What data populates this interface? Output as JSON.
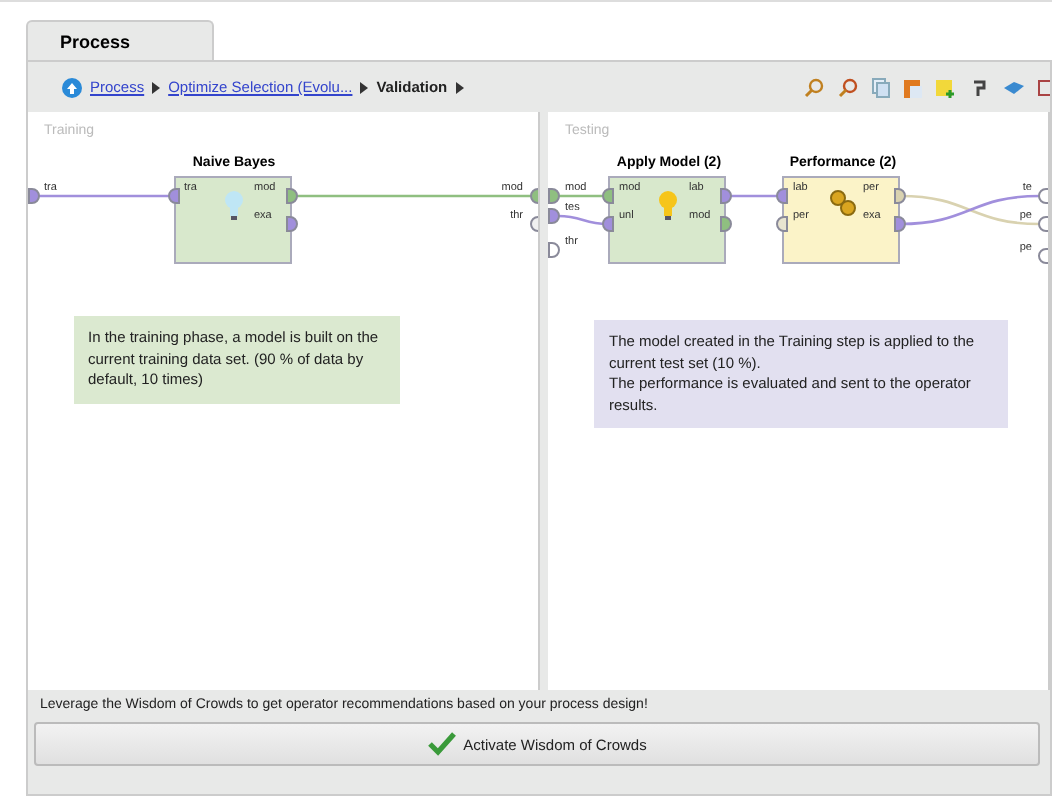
{
  "tab": {
    "label": "Process",
    "selected": true
  },
  "breadcrumb": [
    {
      "label": "Process",
      "kind": "link"
    },
    {
      "label": "Optimize Selection (Evolu...",
      "kind": "link"
    },
    {
      "label": "Validation",
      "kind": "current"
    }
  ],
  "panes": [
    {
      "title": "Training",
      "inputs": [
        {
          "label": "tra",
          "color": "#a18fdc"
        }
      ],
      "outputs": [
        {
          "label": "mod",
          "color": "#8fbf80"
        },
        {
          "label": "thr",
          "color": "#f0f0f0"
        }
      ],
      "operators": [
        {
          "name": "Naive Bayes",
          "kind": "learner",
          "inputs": [
            {
              "label": "tra",
              "color": "#a18fdc"
            }
          ],
          "outputs": [
            {
              "label": "mod",
              "color": "#8fbf80"
            },
            {
              "label": "exa",
              "color": "#a18fdc"
            }
          ]
        }
      ],
      "note": {
        "text": "In the training phase, a model is built on the current training data set. (90 % of data by default, 10 times)",
        "color": "#dbe9d0"
      }
    },
    {
      "title": "Testing",
      "inputs": [
        {
          "label": "mod",
          "color": "#8fbf80"
        },
        {
          "label": "tes",
          "color": "#a18fdc"
        },
        {
          "label": "thr",
          "color": "#ffffff"
        }
      ],
      "outputs": [
        {
          "label": "te",
          "color": "#ffffff"
        },
        {
          "label": "pe",
          "color": "#ffffff"
        },
        {
          "label": "pe",
          "color": "#ffffff"
        }
      ],
      "operators": [
        {
          "name": "Apply Model (2)",
          "kind": "applier",
          "inputs": [
            {
              "label": "mod",
              "color": "#8fbf80"
            },
            {
              "label": "unl",
              "color": "#a18fdc"
            }
          ],
          "outputs": [
            {
              "label": "lab",
              "color": "#a18fdc"
            },
            {
              "label": "mod",
              "color": "#8fbf80"
            }
          ]
        },
        {
          "name": "Performance (2)",
          "kind": "evaluator",
          "inputs": [
            {
              "label": "lab",
              "color": "#a18fdc"
            },
            {
              "label": "per",
              "color": "#e8e4d0"
            }
          ],
          "outputs": [
            {
              "label": "per",
              "color": "#d9d2b0"
            },
            {
              "label": "exa",
              "color": "#a18fdc"
            }
          ]
        }
      ],
      "note": {
        "text": "The model created in the Training step is applied to the current test set (10 %).\nThe performance is evaluated and sent to the operator results.",
        "color": "#e2e0f0"
      }
    }
  ],
  "hint": "Leverage the Wisdom of Crowds to get operator recommendations based on your process design!",
  "action": {
    "label": "Activate Wisdom of Crowds"
  }
}
